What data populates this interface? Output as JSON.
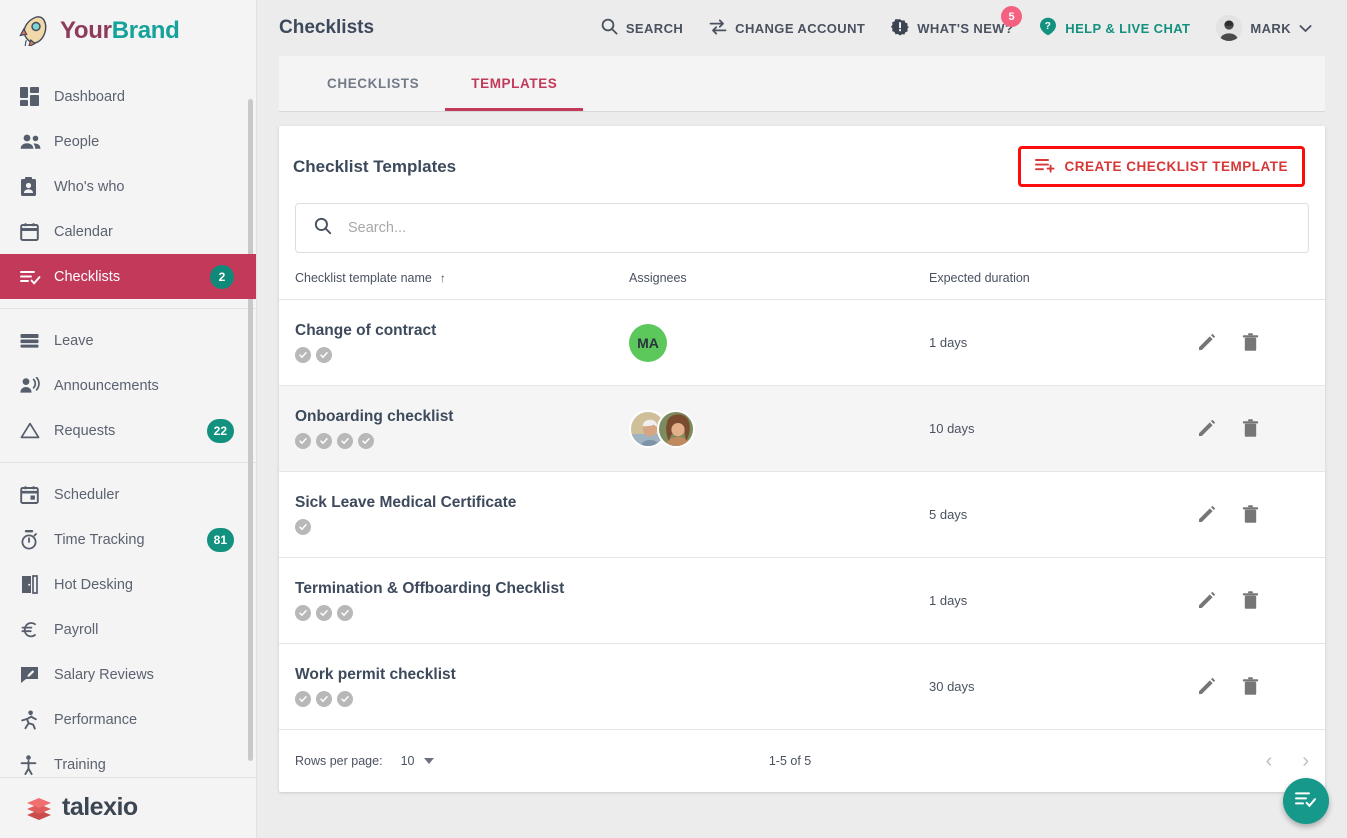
{
  "brand": {
    "your": "Your",
    "name": "Brand",
    "logo_icon": "rocket-icon"
  },
  "sidebar": {
    "items": [
      {
        "label": "Dashboard",
        "icon": "dashboard-icon",
        "badge": "",
        "active": false
      },
      {
        "label": "People",
        "icon": "people-icon",
        "badge": "",
        "active": false
      },
      {
        "label": "Who's who",
        "icon": "contact-card-icon",
        "badge": "",
        "active": false
      },
      {
        "label": "Calendar",
        "icon": "calendar-icon",
        "badge": "",
        "active": false
      },
      {
        "label": "Checklists",
        "icon": "checklist-icon",
        "badge": "2",
        "active": true
      },
      {
        "label": "Leave",
        "icon": "leave-icon",
        "badge": "",
        "active": false
      },
      {
        "label": "Announcements",
        "icon": "announcement-icon",
        "badge": "",
        "active": false
      },
      {
        "label": "Requests",
        "icon": "requests-icon",
        "badge": "22",
        "active": false
      },
      {
        "label": "Scheduler",
        "icon": "scheduler-icon",
        "badge": "",
        "active": false
      },
      {
        "label": "Time Tracking",
        "icon": "stopwatch-icon",
        "badge": "81",
        "active": false
      },
      {
        "label": "Hot Desking",
        "icon": "hot-desking-icon",
        "badge": "",
        "active": false
      },
      {
        "label": "Payroll",
        "icon": "euro-icon",
        "badge": "",
        "active": false
      },
      {
        "label": "Salary Reviews",
        "icon": "salary-review-icon",
        "badge": "",
        "active": false
      },
      {
        "label": "Performance",
        "icon": "performance-icon",
        "badge": "",
        "active": false
      },
      {
        "label": "Training",
        "icon": "training-icon",
        "badge": "",
        "active": false
      }
    ],
    "footer_brand": "talexio"
  },
  "header": {
    "title": "Checklists",
    "actions": [
      {
        "label": "SEARCH",
        "icon": "search-icon",
        "badge": "",
        "style": "default"
      },
      {
        "label": "CHANGE ACCOUNT",
        "icon": "swap-icon",
        "badge": "",
        "style": "default"
      },
      {
        "label": "WHAT'S NEW?",
        "icon": "alert-icon",
        "badge": "5",
        "style": "default"
      },
      {
        "label": "HELP & LIVE CHAT",
        "icon": "help-icon",
        "badge": "",
        "style": "teal"
      }
    ],
    "user": {
      "name": "MARK",
      "avatar_icon": "user-avatar",
      "chevron": "chevron-down-icon"
    }
  },
  "tabs": [
    {
      "label": "CHECKLISTS",
      "active": false
    },
    {
      "label": "TEMPLATES",
      "active": true
    }
  ],
  "card": {
    "title": "Checklist Templates",
    "create_button": {
      "label": "CREATE CHECKLIST TEMPLATE",
      "icon": "list-add-icon",
      "outline_color": "#fb0d0d",
      "text_color": "#d73737"
    }
  },
  "search": {
    "value": "",
    "placeholder": "Search...",
    "icon": "search-icon"
  },
  "table": {
    "columns": [
      {
        "key": "name",
        "label": "Checklist template name",
        "sort": "asc",
        "sort_icon": "arrow-up-icon"
      },
      {
        "key": "assignees",
        "label": "Assignees"
      },
      {
        "key": "duration",
        "label": "Expected duration"
      },
      {
        "key": "actions",
        "label": ""
      }
    ],
    "row_actions": [
      {
        "label": "Edit",
        "icon": "pencil-icon"
      },
      {
        "label": "Delete",
        "icon": "trash-icon"
      }
    ],
    "rows": [
      {
        "name": "Change of contract",
        "steps": 2,
        "assignees": [
          {
            "type": "initials",
            "initials": "MA",
            "color": "#5cc85c"
          }
        ],
        "duration": "1 days",
        "highlighted": false
      },
      {
        "name": "Onboarding checklist",
        "steps": 4,
        "assignees": [
          {
            "type": "photo",
            "photo": "male-portrait"
          },
          {
            "type": "photo",
            "photo": "female-portrait"
          }
        ],
        "duration": "10 days",
        "highlighted": true
      },
      {
        "name": "Sick Leave Medical Certificate",
        "steps": 1,
        "assignees": [],
        "duration": "5 days",
        "highlighted": false
      },
      {
        "name": "Termination & Offboarding Checklist",
        "steps": 3,
        "assignees": [],
        "duration": "1 days",
        "highlighted": false
      },
      {
        "name": "Work permit checklist",
        "steps": 3,
        "assignees": [],
        "duration": "30 days",
        "highlighted": false
      }
    ]
  },
  "footer": {
    "rows_per_page_label": "Rows per page:",
    "rows_per_page_value": "10",
    "range": "1-5 of 5",
    "prev_icon": "chevron-left-icon",
    "next_icon": "chevron-right-icon"
  },
  "fab": {
    "icon": "checklist-icon",
    "color": "#16998a"
  },
  "colors": {
    "accent_red": "#c2395a",
    "teal": "#13917f",
    "badge_pink": "#f4607f",
    "avatar_green": "#5cc85c",
    "highlight_red": "#fb0d0d"
  }
}
